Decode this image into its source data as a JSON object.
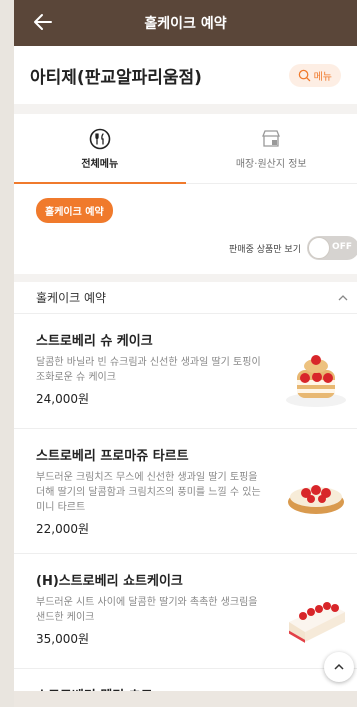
{
  "header": {
    "title": "홀케이크 예약",
    "back_icon": "arrow-left-icon"
  },
  "store": {
    "name": "아티제(판교알파리움점)",
    "menu_button_label": "메뉴"
  },
  "tabs": [
    {
      "label": "전체메뉴",
      "icon": "utensils-icon",
      "active": true
    },
    {
      "label": "매장·원산지 정보",
      "icon": "store-icon",
      "active": false
    }
  ],
  "category_chip": "홀케이크 예약",
  "filter": {
    "label": "판매중 상품만 보기",
    "toggle_text": "OFF"
  },
  "section": {
    "title": "홀케이크 예약"
  },
  "items": [
    {
      "name": "스트로베리 슈 케이크",
      "desc": "달콤한 바닐라 빈 슈크림과 신선한 생과일 딸기 토핑이 조화로운 슈 케이크",
      "price": "24,000원"
    },
    {
      "name": "스트로베리 프로마쥬 타르트",
      "desc": "부드러운 크림치즈 무스에 신선한 생과일 딸기 토핑을 더해 딸기의 달콤함과 크림치즈의 풍미를 느낄 수 있는 미니 타르트",
      "price": "22,000원"
    },
    {
      "name": "(H)스트로베리 쇼트케이크",
      "desc": "부드러운 시트 사이에 달콤한 딸기와 촉촉한 생크림을 샌드한 케이크",
      "price": "35,000원"
    },
    {
      "name": "스트로베리 멜팅 초코",
      "desc": "",
      "price": ""
    }
  ],
  "colors": {
    "header_bg": "#5a4639",
    "accent": "#f07a2c"
  }
}
